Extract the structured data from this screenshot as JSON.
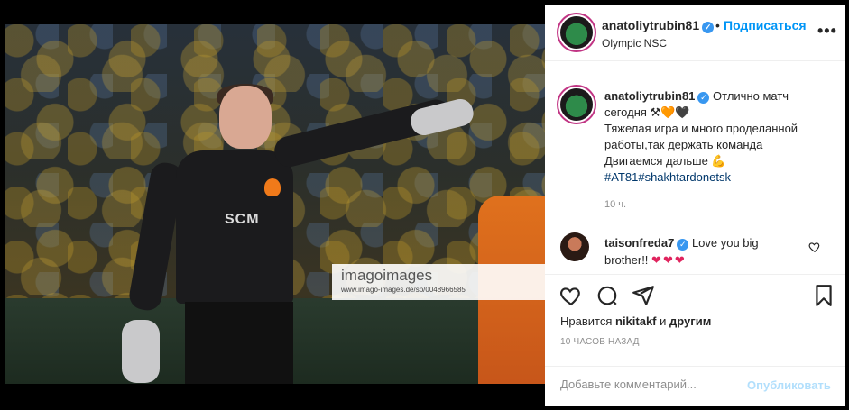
{
  "post": {
    "username": "anatoliytrubin81",
    "follow_label": "Подписаться",
    "dot": "•",
    "location": "Olympic NSC",
    "more_label": "•••"
  },
  "photo": {
    "watermark_brand": "imagoimages",
    "watermark_url": "www.imago-images.de/sp/0048966585",
    "sponsor": "SCM"
  },
  "caption": {
    "username": "anatoliytrubin81",
    "line1": "Отлично матч сегодня ⚒🧡🖤",
    "line2": "Тяжелая игра и много проделанной работы,так держать команда",
    "line3": "Двигаемся дальше 💪",
    "hashtags": "#AT81#shakhtardonetsk",
    "time": "10 ч."
  },
  "comment": {
    "username": "taisonfreda7",
    "text": "Love you big brother!!",
    "hearts": "❤❤❤"
  },
  "likes": {
    "prefix": "Нравится",
    "user": "nikitakf",
    "middle": "и",
    "others": "другим"
  },
  "timestamp": "10 ЧАСОВ НАЗАД",
  "add_comment": {
    "placeholder": "Добавьте комментарий...",
    "post_label": "Опубликовать"
  },
  "colors": {
    "follow": "#0095f6",
    "verified": "#3897f0",
    "post_disabled": "#b2dffc",
    "hashtag": "#00376b"
  }
}
